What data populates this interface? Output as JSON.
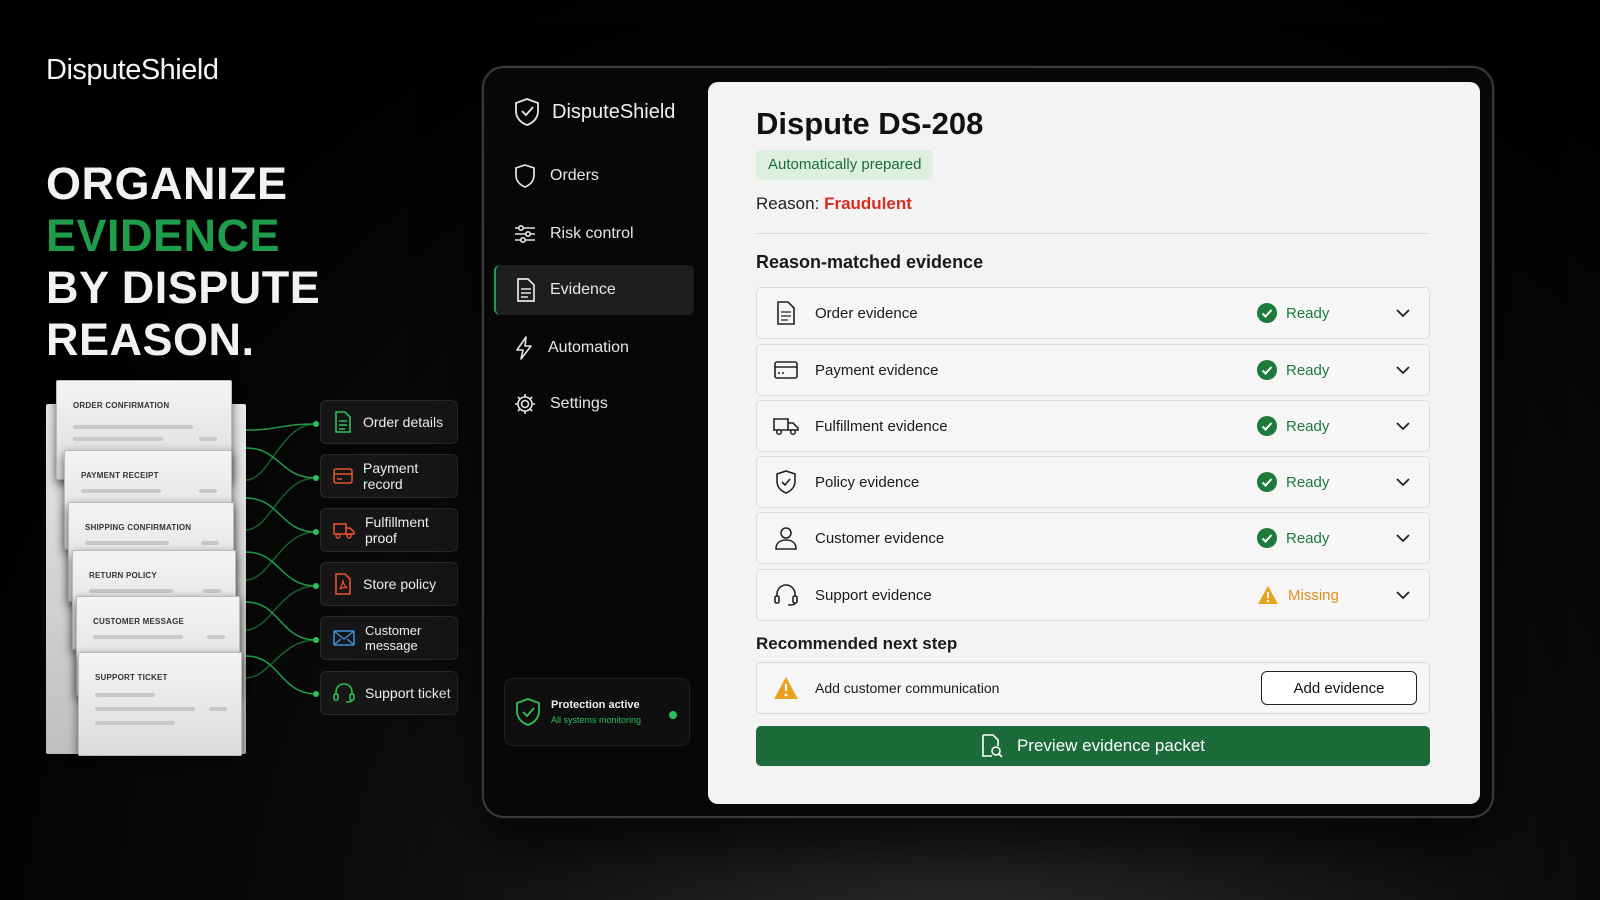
{
  "brand": {
    "name": "DisputeShield"
  },
  "headline": {
    "line1": "ORGANIZE",
    "line2": "EVIDENCE",
    "line3": "BY DISPUTE",
    "line4": "REASON."
  },
  "documents": [
    "ORDER CONFIRMATION",
    "PAYMENT RECEIPT",
    "SHIPPING CONFIRMATION",
    "RETURN POLICY",
    "CUSTOMER MESSAGE",
    "SUPPORT TICKET"
  ],
  "chips": [
    {
      "label": "Order details",
      "icon": "document-icon",
      "color": "#2fbf5b"
    },
    {
      "label": "Payment record",
      "icon": "card-icon",
      "color": "#e8532a"
    },
    {
      "label": "Fulfillment proof",
      "icon": "truck-icon",
      "color": "#e8532a"
    },
    {
      "label": "Store policy",
      "icon": "pdf-icon",
      "color": "#e8532a"
    },
    {
      "label": "Customer message",
      "icon": "mail-icon",
      "color": "#3a8fd8"
    },
    {
      "label": "Support ticket",
      "icon": "headset-icon",
      "color": "#2fbf5b"
    }
  ],
  "sidebar": {
    "brand": "DisputeShield",
    "items": [
      {
        "label": "Orders",
        "icon": "shield-icon"
      },
      {
        "label": "Risk control",
        "icon": "sliders-icon"
      },
      {
        "label": "Evidence",
        "icon": "document-icon",
        "active": true
      },
      {
        "label": "Automation",
        "icon": "lightning-icon"
      },
      {
        "label": "Settings",
        "icon": "gear-icon"
      }
    ],
    "protection": {
      "title": "Protection active",
      "subtitle": "All systems monitoring"
    }
  },
  "main": {
    "title": "Dispute DS-208",
    "badge": "Automatically prepared",
    "reason_label": "Reason:",
    "reason_value": "Fraudulent",
    "section_evidence": "Reason-matched evidence",
    "evidence": [
      {
        "label": "Order evidence",
        "icon": "document-icon",
        "status": "Ready"
      },
      {
        "label": "Payment evidence",
        "icon": "card-icon",
        "status": "Ready"
      },
      {
        "label": "Fulfillment evidence",
        "icon": "truck-icon",
        "status": "Ready"
      },
      {
        "label": "Policy evidence",
        "icon": "shield-check-icon",
        "status": "Ready"
      },
      {
        "label": "Customer evidence",
        "icon": "user-icon",
        "status": "Ready"
      },
      {
        "label": "Support evidence",
        "icon": "headset-icon",
        "status": "Missing"
      }
    ],
    "section_next": "Recommended next step",
    "next_step": {
      "label": "Add customer communication",
      "button": "Add evidence"
    },
    "preview_button": "Preview evidence packet"
  },
  "colors": {
    "accent": "#1f9d4a",
    "ready": "#1c7a3c",
    "missing": "#e0901a",
    "reason": "#d92c20",
    "primary_button": "#1a6b38"
  }
}
